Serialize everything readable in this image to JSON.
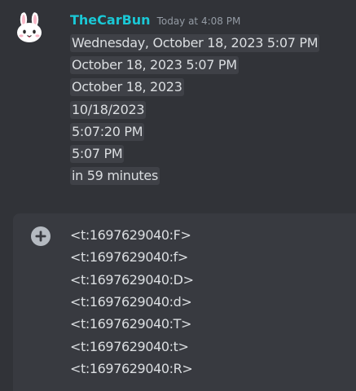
{
  "message": {
    "author": "TheCarBun",
    "timestamp": "Today at 4:08 PM",
    "avatar_icon": "bunny-icon",
    "author_color": "#1ac8d6",
    "timestamps": [
      "Wednesday, October 18, 2023 5:07 PM",
      "October 18, 2023 5:07 PM",
      "October 18, 2023",
      "10/18/2023",
      "5:07:20 PM",
      "5:07 PM",
      "in 59 minutes"
    ]
  },
  "composer": {
    "attach_icon": "plus-circle-icon",
    "lines": [
      "<t:1697629040:F>",
      "<t:1697629040:f>",
      "<t:1697629040:D>",
      "<t:1697629040:d>",
      "<t:1697629040:T>",
      "<t:1697629040:t>",
      "<t:1697629040:R>"
    ]
  }
}
